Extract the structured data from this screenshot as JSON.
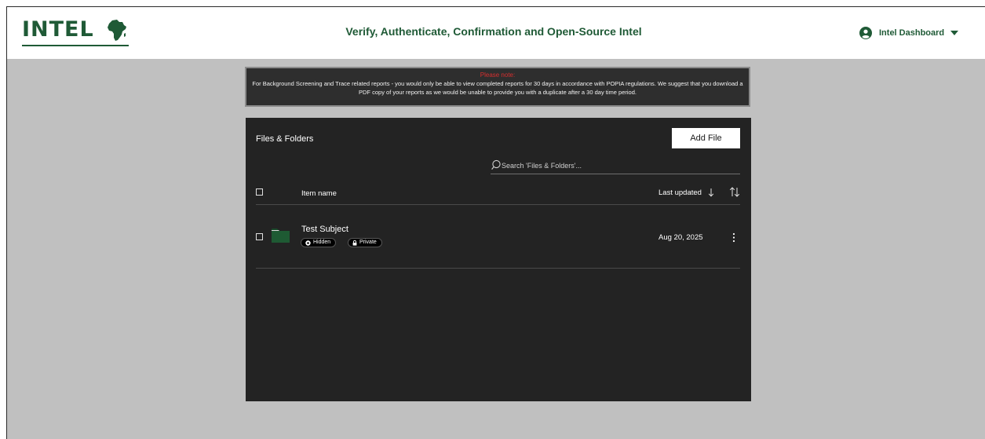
{
  "header": {
    "logo_text": "INTEL",
    "tagline": "Verify, Authenticate, Confirmation and Open-Source Intel",
    "user_menu_label": "Intel Dashboard",
    "brand_color": "#1f5a36"
  },
  "notice": {
    "title": "Please note:",
    "body": "For Background Screening and Trace related reports - you would only be able to view completed reports for 30 days in accordance with POPIA regulations. We suggest that you download a PDF copy of your reports as we would be unable to provide you with a duplicate after a 30 day time period.",
    "title_color": "#d62f2f"
  },
  "panel": {
    "title": "Files & Folders",
    "add_file_label": "Add File",
    "search_placeholder": "Search 'Files & Folders'...",
    "columns": {
      "name": "Item name",
      "updated": "Last updated"
    },
    "items": [
      {
        "title": "Test Subject",
        "badges": [
          "Hidden",
          "Private"
        ],
        "date": "Aug 20, 2025",
        "icon": "folder-icon",
        "folder_color": "#1e5a33"
      }
    ]
  },
  "icons": {
    "logo_mark": "africa-icon",
    "user": "user-circle-icon",
    "dropdown": "caret-down-icon",
    "search": "search-icon",
    "sort": "arrow-down-icon",
    "sort_toggle": "sort-toggle-icon",
    "hidden": "eye-icon",
    "private": "lock-icon",
    "more": "kebab-icon"
  }
}
